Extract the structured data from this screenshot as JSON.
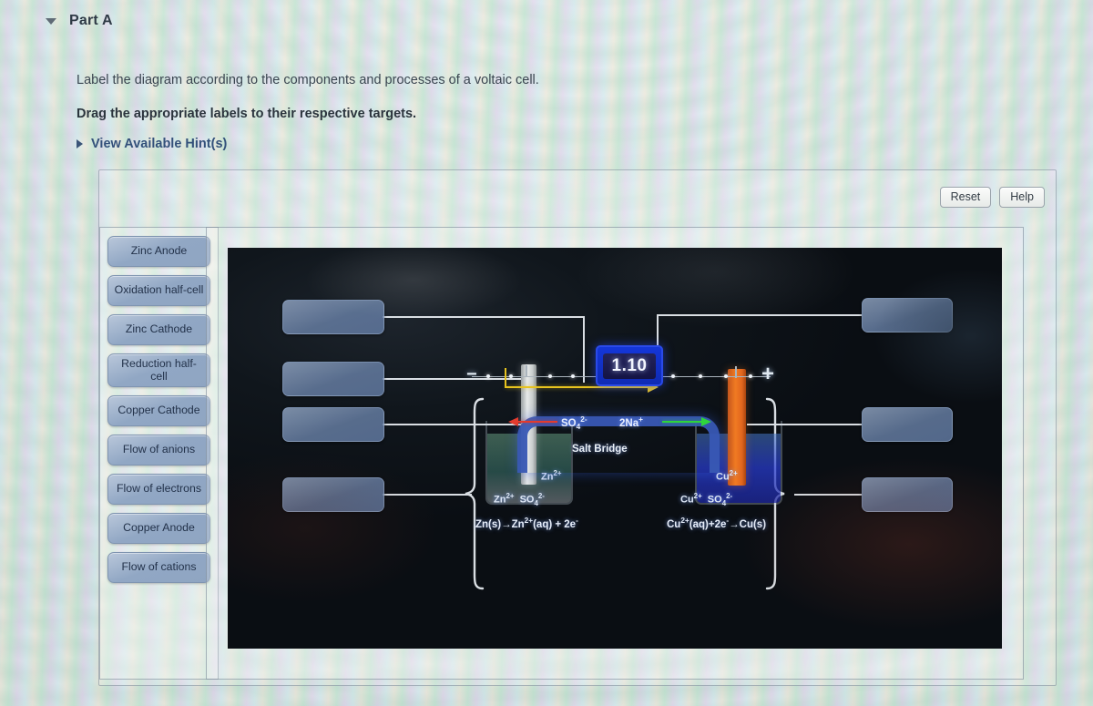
{
  "header": {
    "part_title": "Part A",
    "collapse_icon": "caret-down-icon"
  },
  "prompt": {
    "line1": "Label the diagram according to the components and processes of a voltaic cell.",
    "line2": "Drag the appropriate labels to their respective targets.",
    "hints_label": "View Available Hint(s)",
    "hints_icon": "caret-right-icon"
  },
  "toolbar": {
    "reset_label": "Reset",
    "help_label": "Help"
  },
  "label_bank": {
    "items": [
      {
        "label": "Zinc Anode"
      },
      {
        "label": "Oxidation half-cell"
      },
      {
        "label": "Zinc Cathode"
      },
      {
        "label": "Reduction half-cell"
      },
      {
        "label": "Copper Cathode"
      },
      {
        "label": "Flow of anions"
      },
      {
        "label": "Flow of electrons"
      },
      {
        "label": "Copper Anode"
      },
      {
        "label": "Flow of cations"
      }
    ]
  },
  "diagram": {
    "targets": [
      {
        "name": "drop-target-1",
        "value": ""
      },
      {
        "name": "drop-target-2",
        "value": ""
      },
      {
        "name": "drop-target-3",
        "value": ""
      },
      {
        "name": "drop-target-4",
        "value": ""
      },
      {
        "name": "drop-target-5",
        "value": ""
      },
      {
        "name": "drop-target-6",
        "value": ""
      },
      {
        "name": "drop-target-7",
        "value": ""
      }
    ],
    "voltmeter_reading": "1.10",
    "terminal_negative": "−",
    "terminal_positive": "+",
    "salt_bridge_label": "Salt Bridge",
    "salt_bridge_anion": "SO4 2-",
    "salt_bridge_cation": "2Na +",
    "left_cell": {
      "solution_ion_top": "Zn 2+",
      "solution_ion_cation": "Zn 2+",
      "solution_ion_anion": "SO4 2-",
      "half_reaction": "Zn(s) → Zn2+(aq) + 2e−"
    },
    "right_cell": {
      "solution_ion_top": "Cu 2+",
      "solution_ion_cation": "Cu 2+",
      "solution_ion_anion": "SO4 2-",
      "half_reaction": "Cu2+(aq) + 2e− → Cu(s)"
    },
    "colors": {
      "chip": "#91a7c4",
      "target": "#6880a6",
      "voltmeter": "#1436d8",
      "zinc_electrode": "#d4d8d8",
      "copper_electrode": "#f07a22",
      "salt_bridge": "#2642 96",
      "anion_arrow": "#e23b2e",
      "cation_arrow": "#2fd43c",
      "electron_arrow": "#e7c31f"
    }
  }
}
